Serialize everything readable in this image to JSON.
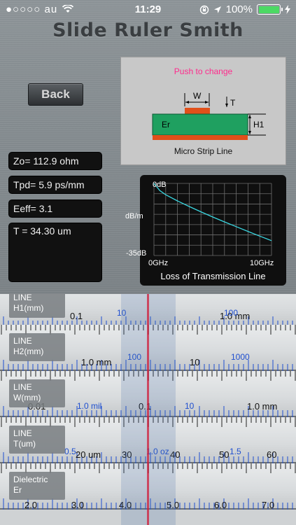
{
  "status_bar": {
    "signal": "●○○○○",
    "carrier": "au",
    "time": "11:29",
    "battery": "100%"
  },
  "app_title": "Slide Ruler Smith",
  "back_button": "Back",
  "diagram": {
    "push_text": "Push to change",
    "caption": "Micro Strip Line",
    "labels": {
      "w": "W",
      "t": "T",
      "h1": "H1",
      "er": "Er"
    }
  },
  "results": {
    "zo": "Zo= 112.9 ohm",
    "tpd": "Tpd=   5.9 ps/mm",
    "eeff": "Eeff=   3.1",
    "t": "T = 34.30 um"
  },
  "graph": {
    "y_top": "0dB",
    "y_unit": "dB/m",
    "y_bottom": "-35dB",
    "x_left": "0GHz",
    "x_right": "10GHz",
    "caption": "Loss of Transmission Line",
    "chart_data": {
      "type": "line",
      "xlim": [
        0,
        10
      ],
      "ylim": [
        -35,
        0
      ],
      "x": [
        0,
        0.5,
        1,
        2,
        3,
        4,
        5,
        6,
        7,
        8,
        9,
        10
      ],
      "y": [
        0,
        -3.5,
        -5.5,
        -8.5,
        -11.2,
        -13.8,
        -16.3,
        -18.7,
        -21.0,
        -23.3,
        -25.6,
        -27.8
      ],
      "line_color": "#3ad6e0"
    }
  },
  "rules": [
    {
      "label_line1": "LINE",
      "label_line2": "H1(mm)",
      "black": [
        "0.1",
        "1.0 mm"
      ],
      "blue": [
        "10",
        "100"
      ]
    },
    {
      "label_line1": "LINE",
      "label_line2": "H2(mm)",
      "black": [
        "1.0 mm",
        "10"
      ],
      "blue": [
        "100",
        "1000"
      ]
    },
    {
      "label_line1": "LINE",
      "label_line2": "W(mm)",
      "black": [
        "0.01",
        "0.1",
        "1.0 mm"
      ],
      "blue": [
        "1.0  mil",
        "10"
      ]
    },
    {
      "label_line1": "LINE",
      "label_line2": "T(um)",
      "black": [
        "20 um",
        "30",
        "40",
        "50",
        "60"
      ],
      "blue": [
        "0.5",
        "1.0 oz",
        "1.5"
      ]
    },
    {
      "label_line1": "Dielectric",
      "label_line2": "Er",
      "black": [
        "2.0",
        "3.0",
        "4.0",
        "5.0",
        "6.0",
        "7.0"
      ],
      "blue": []
    }
  ],
  "colors": {
    "accent_pink": "#ff2a8c",
    "cursor_red": "#d01c3a",
    "scale_blue": "#1f4fd0",
    "curve_cyan": "#3ad6e0"
  }
}
